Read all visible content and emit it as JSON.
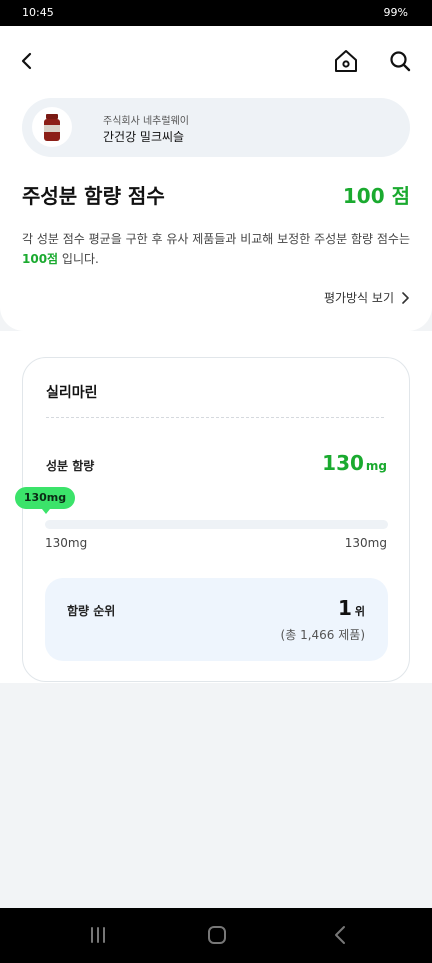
{
  "status": {
    "time": "10:45",
    "battery": "99%"
  },
  "header": {
    "back_icon": "chevron-left-icon",
    "home_icon": "home-icon",
    "search_icon": "search-icon"
  },
  "product": {
    "company": "주식회사 네추럴웨이",
    "name": "간건강 밀크씨슬"
  },
  "score": {
    "title": "주성분 함량 점수",
    "value": "100 점",
    "desc_before": "각 성분 점수 평균을 구한 후 유사 제품들과 비교해 보정한 주성분 함량 점수는 ",
    "desc_highlight": "100점",
    "desc_after": " 입니다.",
    "method_link": "평가방식 보기"
  },
  "ingredient": {
    "name": "실리마린",
    "content_label": "성분 함량",
    "content_value": "130",
    "content_unit": "mg",
    "marker_label": "130mg",
    "range_min": "130mg",
    "range_max": "130mg",
    "rank_label": "함량 순위",
    "rank_value": "1",
    "rank_unit": "위",
    "rank_total": "(총 1,466 제품)"
  },
  "colors": {
    "accent_green": "#1aaa2f",
    "marker_green": "#3be36a",
    "pill_bg": "#eef2f6",
    "rank_bg": "#eef5fd"
  },
  "nav": {
    "recent_icon": "recent-apps-icon",
    "home_icon": "home-circle-icon",
    "back_icon": "back-icon"
  }
}
